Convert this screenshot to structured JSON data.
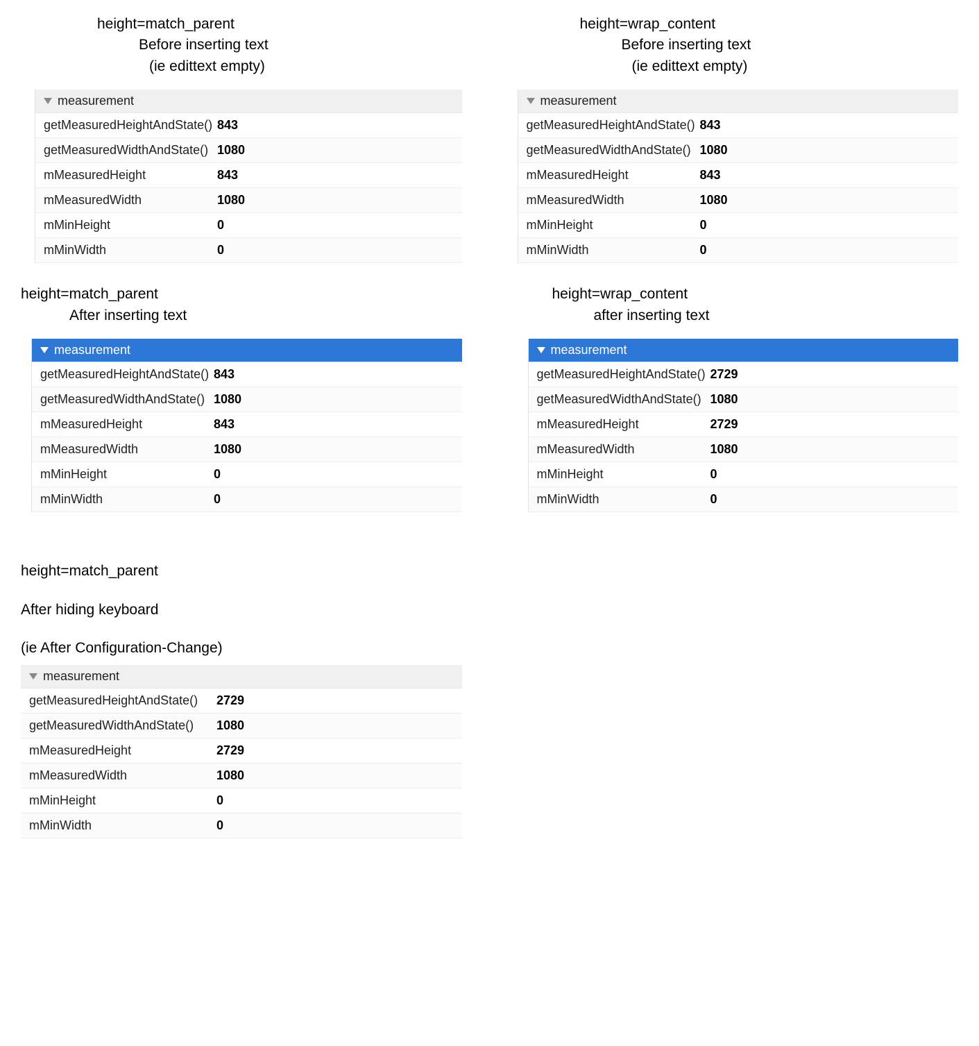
{
  "panels": {
    "top_left": {
      "title1": "height=match_parent",
      "title2": "Before inserting text",
      "title3": "(ie edittext empty)",
      "header": "measurement",
      "selected": false,
      "rows": [
        {
          "key": "getMeasuredHeightAndState()",
          "val": "843"
        },
        {
          "key": "getMeasuredWidthAndState()",
          "val": "1080"
        },
        {
          "key": "mMeasuredHeight",
          "val": "843"
        },
        {
          "key": "mMeasuredWidth",
          "val": "1080"
        },
        {
          "key": "mMinHeight",
          "val": "0"
        },
        {
          "key": "mMinWidth",
          "val": "0"
        }
      ]
    },
    "top_right": {
      "title1": "height=wrap_content",
      "title2": "Before inserting text",
      "title3": "(ie edittext empty)",
      "header": "measurement",
      "selected": false,
      "rows": [
        {
          "key": "getMeasuredHeightAndState()",
          "val": "843"
        },
        {
          "key": "getMeasuredWidthAndState()",
          "val": "1080"
        },
        {
          "key": "mMeasuredHeight",
          "val": "843"
        },
        {
          "key": "mMeasuredWidth",
          "val": "1080"
        },
        {
          "key": "mMinHeight",
          "val": "0"
        },
        {
          "key": "mMinWidth",
          "val": "0"
        }
      ]
    },
    "mid_left": {
      "title1": "height=match_parent",
      "title2": "After inserting text",
      "header": "measurement",
      "selected": true,
      "rows": [
        {
          "key": "getMeasuredHeightAndState()",
          "val": "843"
        },
        {
          "key": "getMeasuredWidthAndState()",
          "val": "1080"
        },
        {
          "key": "mMeasuredHeight",
          "val": "843"
        },
        {
          "key": "mMeasuredWidth",
          "val": "1080"
        },
        {
          "key": "mMinHeight",
          "val": "0"
        },
        {
          "key": "mMinWidth",
          "val": "0"
        }
      ]
    },
    "mid_right": {
      "title1": "height=wrap_content",
      "title2": "after inserting text",
      "header": "measurement",
      "selected": true,
      "rows": [
        {
          "key": "getMeasuredHeightAndState()",
          "val": "2729"
        },
        {
          "key": "getMeasuredWidthAndState()",
          "val": "1080"
        },
        {
          "key": "mMeasuredHeight",
          "val": "2729"
        },
        {
          "key": "mMeasuredWidth",
          "val": "1080"
        },
        {
          "key": "mMinHeight",
          "val": "0"
        },
        {
          "key": "mMinWidth",
          "val": "0"
        }
      ]
    },
    "bottom_left": {
      "title1": "height=match_parent",
      "title2": "After hiding keyboard",
      "title3": "(ie After Configuration-Change)",
      "header": "measurement",
      "selected": false,
      "rows": [
        {
          "key": "getMeasuredHeightAndState()",
          "val": "2729"
        },
        {
          "key": "getMeasuredWidthAndState()",
          "val": "1080"
        },
        {
          "key": "mMeasuredHeight",
          "val": "2729"
        },
        {
          "key": "mMeasuredWidth",
          "val": "1080"
        },
        {
          "key": "mMinHeight",
          "val": "0"
        },
        {
          "key": "mMinWidth",
          "val": "0"
        }
      ]
    }
  }
}
